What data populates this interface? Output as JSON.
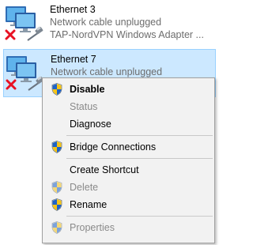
{
  "adapters": [
    {
      "name": "Ethernet 3",
      "status": "Network cable unplugged",
      "device": "TAP-NordVPN Windows Adapter ...",
      "icon": "network-adapter-icon",
      "status_icon": "disconnected-x-icon",
      "selected": false
    },
    {
      "name": "Ethernet 7",
      "status": "Network cable unplugged",
      "device": "",
      "icon": "network-adapter-icon",
      "status_icon": "disconnected-x-icon",
      "selected": true
    }
  ],
  "context_menu": {
    "items": [
      {
        "label": "Disable",
        "shield": true,
        "bold": true,
        "enabled": true
      },
      {
        "label": "Status",
        "shield": false,
        "bold": false,
        "enabled": false
      },
      {
        "label": "Diagnose",
        "shield": false,
        "bold": false,
        "enabled": true
      },
      {
        "label": "Bridge Connections",
        "shield": true,
        "bold": false,
        "enabled": true
      },
      {
        "label": "Create Shortcut",
        "shield": false,
        "bold": false,
        "enabled": true
      },
      {
        "label": "Delete",
        "shield": true,
        "bold": false,
        "enabled": false
      },
      {
        "label": "Rename",
        "shield": true,
        "bold": false,
        "enabled": true
      },
      {
        "label": "Properties",
        "shield": true,
        "bold": false,
        "enabled": false
      }
    ]
  },
  "colors": {
    "selection_bg": "#cce8ff",
    "selection_border": "#99d1ff",
    "menu_bg": "#f2f2f2",
    "disabled_text": "#8a8a8a",
    "status_text": "#6d6d6d",
    "error_red": "#e81123"
  }
}
